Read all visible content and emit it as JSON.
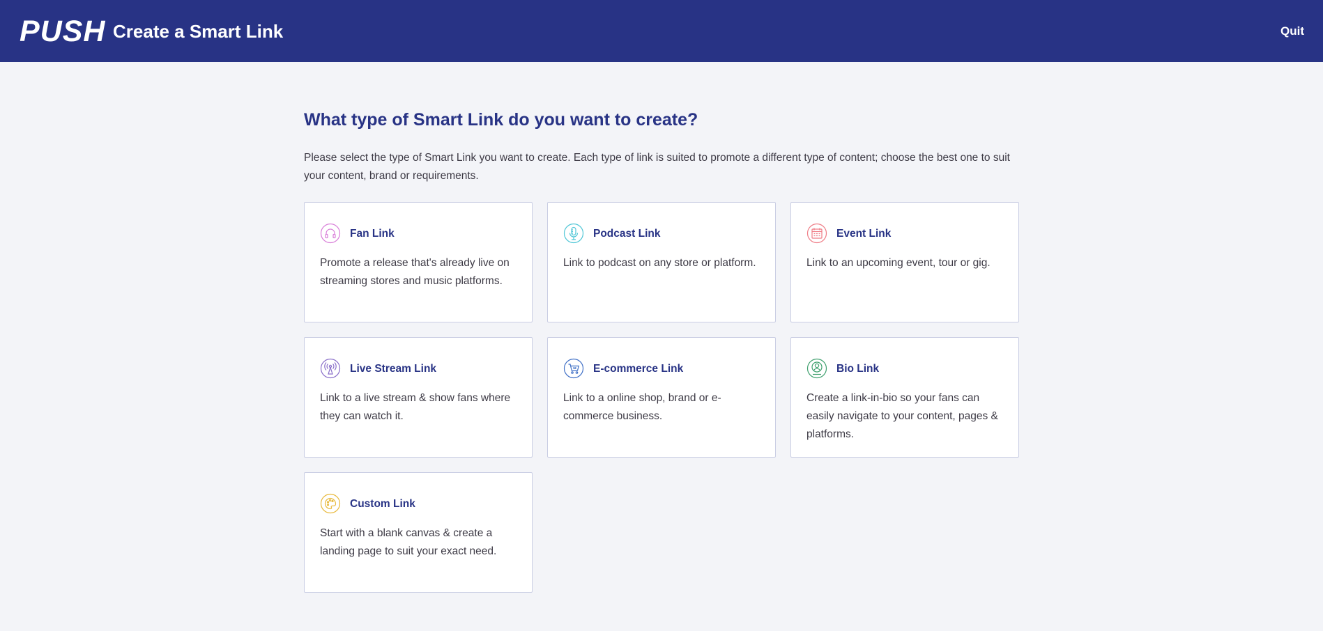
{
  "header": {
    "logo_text": "PUSH",
    "title": "Create a Smart Link",
    "quit_label": "Quit",
    "background": "#283385"
  },
  "main": {
    "heading": "What type of Smart Link do you want to create?",
    "intro": "Please select the type of Smart Link you want to create. Each type of link is suited to promote a different type of content; choose the best one to suit your content, brand or requirements."
  },
  "cards": [
    {
      "title": "Fan Link",
      "description": "Promote a release that's already live on streaming stores and music platforms.",
      "icon": "headphones-icon",
      "icon_color": "#d97fd9"
    },
    {
      "title": "Podcast Link",
      "description": "Link to podcast on any store or platform.",
      "icon": "microphone-icon",
      "icon_color": "#4fc6d6"
    },
    {
      "title": "Event Link",
      "description": "Link to an upcoming event, tour or gig.",
      "icon": "calendar-icon",
      "icon_color": "#ef7c86"
    },
    {
      "title": "Live Stream Link",
      "description": "Link to a live stream & show fans where they can watch it.",
      "icon": "broadcast-icon",
      "icon_color": "#8a6fc9"
    },
    {
      "title": "E-commerce Link",
      "description": "Link to a online shop, brand or e-commerce business.",
      "icon": "shopping-cart-icon",
      "icon_color": "#3f6fc6"
    },
    {
      "title": "Bio Link",
      "description": "Create a link-in-bio so your fans can easily navigate to your content, pages & platforms.",
      "icon": "user-profile-icon",
      "icon_color": "#3fa06e"
    },
    {
      "title": "Custom Link",
      "description": "Start with a blank canvas & create a landing page to suit your exact need.",
      "icon": "palette-icon",
      "icon_color": "#e8b93c"
    }
  ]
}
